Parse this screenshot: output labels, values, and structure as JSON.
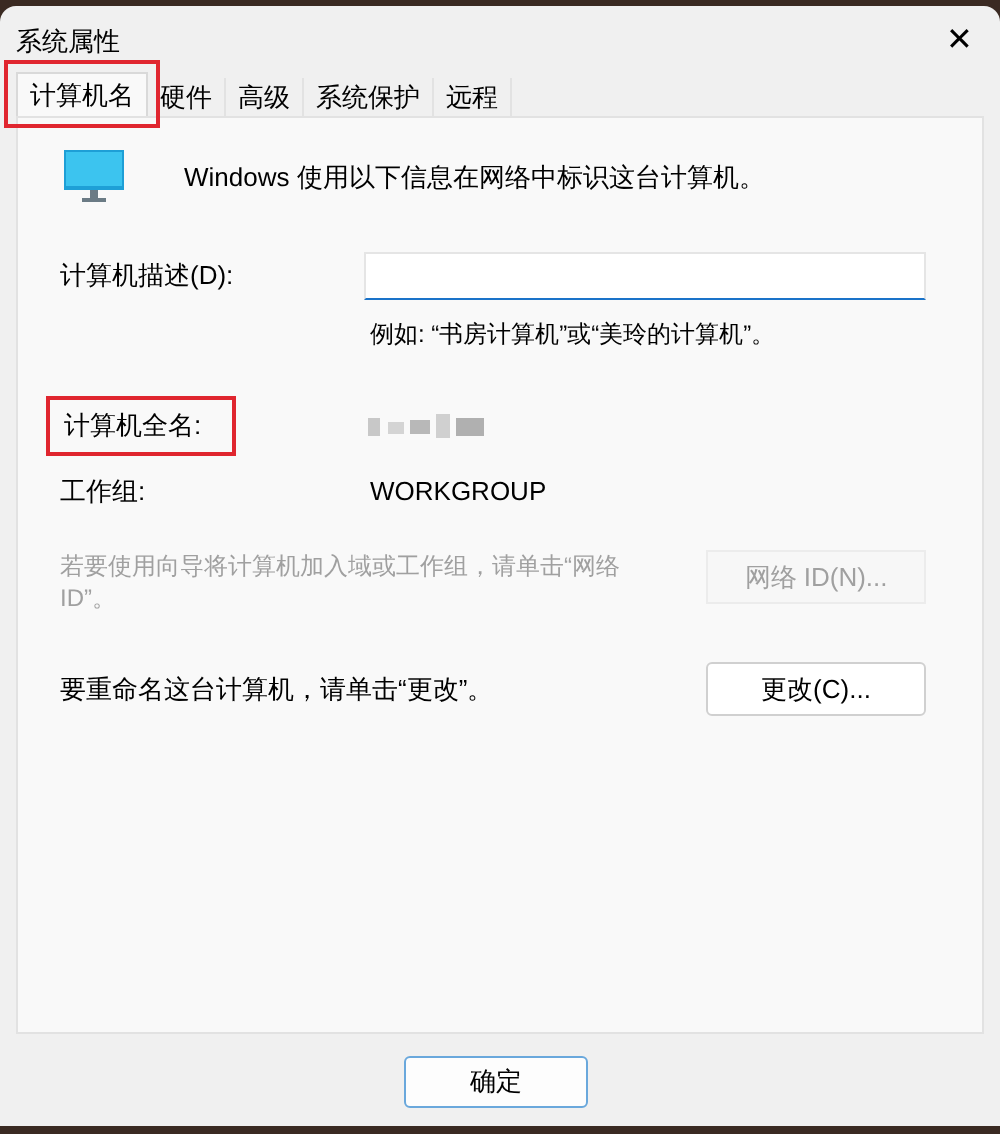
{
  "window": {
    "title": "系统属性",
    "close": "✕"
  },
  "tabs": [
    {
      "label": "计算机名",
      "selected": true,
      "highlighted": true
    },
    {
      "label": "硬件",
      "selected": false,
      "highlighted": false
    },
    {
      "label": "高级",
      "selected": false,
      "highlighted": false
    },
    {
      "label": "系统保护",
      "selected": false,
      "highlighted": false
    },
    {
      "label": "远程",
      "selected": false,
      "highlighted": false
    }
  ],
  "intro": "Windows 使用以下信息在网络中标识这台计算机。",
  "description": {
    "label": "计算机描述(D):",
    "example": "例如: “书房计算机”或“美玲的计算机”。"
  },
  "full_name": {
    "label": "计算机全名:",
    "highlighted": true,
    "value_blurred": true
  },
  "workgroup": {
    "label": "工作组:",
    "value": "WORKGROUP"
  },
  "network": {
    "text": "若要使用向导将计算机加入域或工作组，请单击“网络 ID”。",
    "button": "网络 ID(N)...",
    "disabled": true
  },
  "rename": {
    "text": "要重命名这台计算机，请单击“更改”。",
    "button": "更改(C)...",
    "disabled": false
  },
  "buttons": [
    {
      "label": "确定",
      "default": true
    }
  ]
}
